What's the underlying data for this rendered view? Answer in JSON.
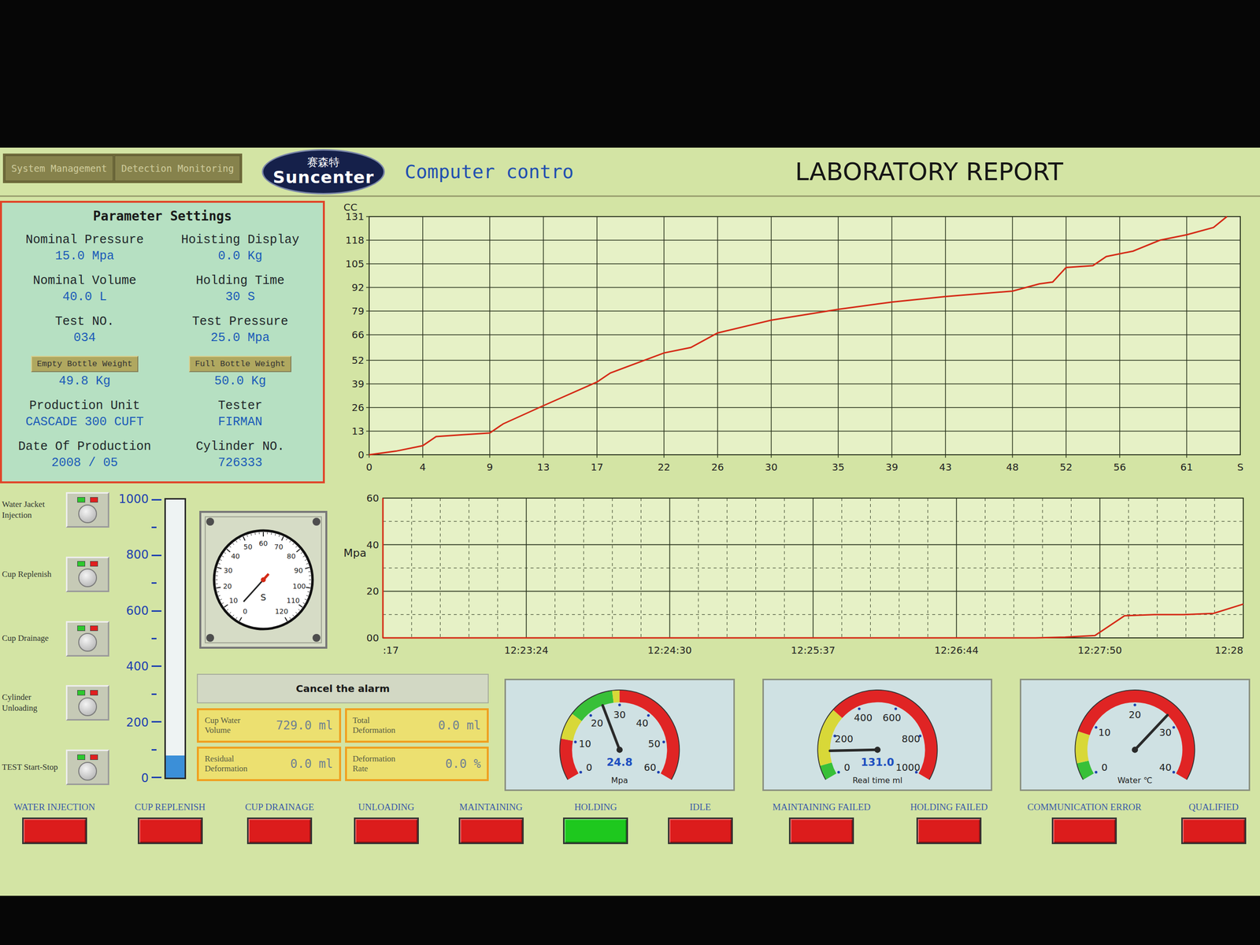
{
  "header": {
    "tabs": [
      {
        "label": "System Management",
        "selected": false
      },
      {
        "label": "Detection Monitoring",
        "selected": false
      }
    ],
    "logo": {
      "chinese": "赛森特",
      "latin": "Suncenter"
    },
    "subtitle": "Computer contro",
    "title": "LABORATORY REPORT"
  },
  "parameters": {
    "title": "Parameter Settings",
    "columns": [
      [
        {
          "label": "Nominal Pressure",
          "kind": "text",
          "value": "15.0 Mpa"
        },
        {
          "label": "Nominal Volume",
          "kind": "text",
          "value": "40.0 L"
        },
        {
          "label": "Test NO.",
          "kind": "text",
          "value": "034"
        },
        {
          "label": "Empty Bottle Weight",
          "kind": "button",
          "value": "49.8 Kg"
        },
        {
          "label": "Production Unit",
          "kind": "text",
          "value": "CASCADE 300 CUFT"
        },
        {
          "label": "Date Of Production",
          "kind": "text",
          "value": "2008 / 05"
        }
      ],
      [
        {
          "label": "Hoisting Display",
          "kind": "text",
          "value": "0.0 Kg"
        },
        {
          "label": "Holding Time",
          "kind": "text",
          "value": "30 S"
        },
        {
          "label": "Test Pressure",
          "kind": "text",
          "value": "25.0 Mpa"
        },
        {
          "label": "Full Bottle Weight",
          "kind": "button",
          "value": "50.0 Kg"
        },
        {
          "label": "Tester",
          "kind": "text",
          "value": "FIRMAN"
        },
        {
          "label": "Cylinder NO.",
          "kind": "text",
          "value": "726333"
        }
      ]
    ]
  },
  "volume_chart": {
    "y_unit": "CC",
    "x_unit": "S",
    "y_ticks": [
      "0",
      "13",
      "26",
      "39",
      "52",
      "66",
      "79",
      "92",
      "105",
      "118",
      "131"
    ],
    "x_ticks": [
      "0",
      "4",
      "9",
      "13",
      "17",
      "22",
      "26",
      "30",
      "35",
      "39",
      "43",
      "48",
      "52",
      "56",
      "61"
    ],
    "series": [
      {
        "name": "volume",
        "times": [
          0,
          2,
          4,
          5,
          7,
          9,
          10,
          13,
          17,
          18,
          22,
          24,
          26,
          30,
          35,
          39,
          43,
          48,
          50,
          51,
          52,
          54,
          55,
          57,
          59,
          61,
          63,
          64
        ],
        "values": [
          0,
          2,
          5,
          10,
          11,
          12,
          17,
          27,
          40,
          45,
          56,
          59,
          67,
          74,
          80,
          84,
          87,
          90,
          94,
          95,
          103,
          104,
          109,
          112,
          118,
          121,
          125,
          131
        ]
      }
    ]
  },
  "pressure_chart": {
    "y_unit": "Mpa",
    "y_ticks": [
      "60",
      "40",
      "20",
      "00"
    ],
    "x_ticks": [
      ":17",
      "12:23:24",
      "12:24:30",
      "12:25:37",
      "12:26:44",
      "12:27:50",
      "12:28"
    ],
    "series": [
      {
        "name": "pressure",
        "values": [
          0,
          0,
          0,
          0,
          0,
          0,
          0,
          0,
          0,
          0,
          0,
          0,
          0,
          0,
          0,
          0,
          0,
          0,
          0,
          0,
          0,
          0,
          0,
          0.3,
          1,
          9.5,
          10,
          10,
          10.5,
          14.5
        ]
      }
    ]
  },
  "controls": [
    {
      "label": "Water Jacket Injection"
    },
    {
      "label": "Cup Replenish"
    },
    {
      "label": "Cup Drainage"
    },
    {
      "label": "Cylinder Unloading"
    },
    {
      "label": "TEST Start-Stop"
    }
  ],
  "tank": {
    "ticks": [
      "1000",
      "800",
      "600",
      "400",
      "200",
      "0"
    ],
    "level": 0.08
  },
  "timer": {
    "ticks": [
      "0",
      "10",
      "20",
      "30",
      "40",
      "50",
      "60",
      "70",
      "80",
      "90",
      "100",
      "110",
      "120"
    ],
    "unit": "S",
    "level": 0.04
  },
  "alarm_button": "Cancel the alarm",
  "readouts": [
    {
      "label": "Cup Water Volume",
      "value": "729.0 ml"
    },
    {
      "label": "Total Deformation",
      "value": "0.0 ml"
    },
    {
      "label": "Residual Deformation",
      "value": "0.0 ml"
    },
    {
      "label": "Deformation Rate",
      "value": "0.0 %"
    }
  ],
  "gauges": [
    {
      "name": "pressure",
      "ticks": [
        "0",
        "10",
        "20",
        "30",
        "40",
        "50",
        "60"
      ],
      "reading": "24.8",
      "unit": "Mpa",
      "level": 0.413,
      "zones": [
        {
          "to": 0.17,
          "color": "#e02424"
        },
        {
          "to": 0.28,
          "color": "#d8d838"
        },
        {
          "to": 0.47,
          "color": "#38c038"
        },
        {
          "to": 0.5,
          "color": "#d8d838"
        },
        {
          "to": 1,
          "color": "#e02424"
        }
      ]
    },
    {
      "name": "volume",
      "ticks": [
        "0",
        "200",
        "400",
        "600",
        "800",
        "1000"
      ],
      "reading": "131.0",
      "unit": "Real time ml",
      "level": 0.12,
      "zones": [
        {
          "to": 0.06,
          "color": "#38c038"
        },
        {
          "to": 0.3,
          "color": "#d8d838"
        },
        {
          "to": 1,
          "color": "#e02424"
        }
      ]
    },
    {
      "name": "water",
      "ticks": [
        "0",
        "10",
        "20",
        "30",
        "40"
      ],
      "unit": "Water ℃",
      "level": 0.68,
      "zones": [
        {
          "to": 0.07,
          "color": "#38c038"
        },
        {
          "to": 0.2,
          "color": "#d8d838"
        },
        {
          "to": 1,
          "color": "#e02424"
        }
      ]
    }
  ],
  "status_lamps": [
    {
      "label": "WATER INJECTION",
      "on": false
    },
    {
      "label": "CUP REPLENISH",
      "on": false
    },
    {
      "label": "CUP DRAINAGE",
      "on": false
    },
    {
      "label": "UNLOADING",
      "on": false
    },
    {
      "label": "MAINTAINING",
      "on": false
    },
    {
      "label": "HOLDING",
      "on": true
    },
    {
      "label": "IDLE",
      "on": false
    },
    {
      "label": "MAINTAINING FAILED",
      "on": false
    },
    {
      "label": "HOLDING FAILED",
      "on": false
    },
    {
      "label": "COMMUNICATION ERROR",
      "on": false
    },
    {
      "label": "QUALIFIED",
      "on": false
    }
  ]
}
